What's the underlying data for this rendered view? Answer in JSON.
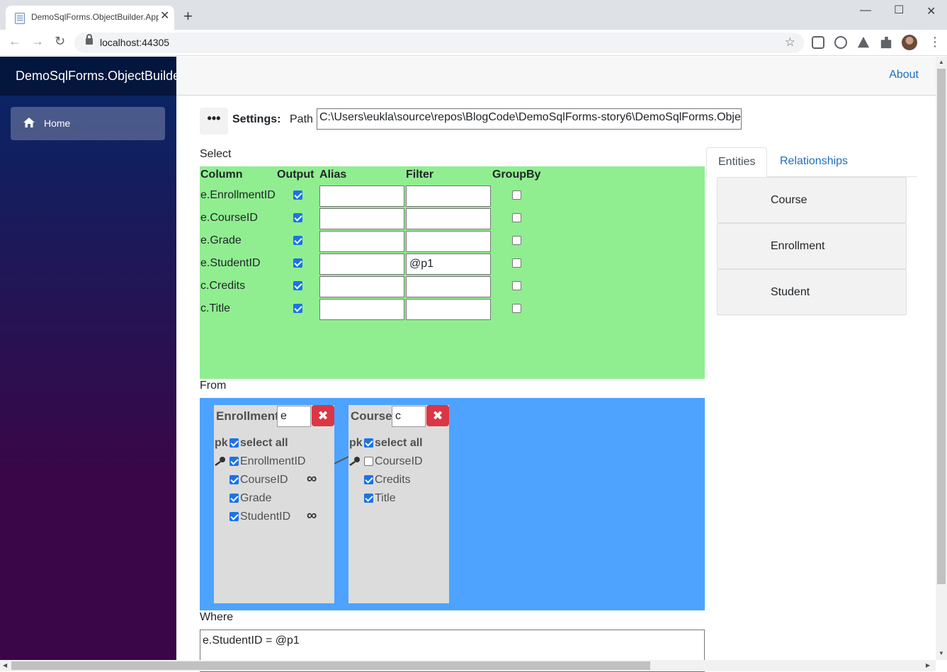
{
  "browser": {
    "tab_title": "DemoSqlForms.ObjectBuilder.App",
    "url": "localhost:44305"
  },
  "app": {
    "brand": "DemoSqlForms.ObjectBuilder.App",
    "nav": [
      {
        "label": "Home",
        "icon": "home-icon"
      }
    ],
    "about_label": "About"
  },
  "settings": {
    "button_label": "•••",
    "label": "Settings:",
    "path_label": "Path",
    "path_value": "C:\\Users\\eukla\\source\\repos\\BlogCode\\DemoSqlForms-story6\\DemoSqlForms.ObjectBuilder.App"
  },
  "select": {
    "section_label": "Select",
    "headers": {
      "column": "Column",
      "output": "Output",
      "alias": "Alias",
      "filter": "Filter",
      "groupby": "GroupBy"
    },
    "rows": [
      {
        "column": "e.EnrollmentID",
        "output": true,
        "alias": "",
        "filter": "",
        "groupby": false
      },
      {
        "column": "e.CourseID",
        "output": true,
        "alias": "",
        "filter": "",
        "groupby": false
      },
      {
        "column": "e.Grade",
        "output": true,
        "alias": "",
        "filter": "",
        "groupby": false
      },
      {
        "column": "e.StudentID",
        "output": true,
        "alias": "",
        "filter": "@p1",
        "groupby": false
      },
      {
        "column": "c.Credits",
        "output": true,
        "alias": "",
        "filter": "",
        "groupby": false
      },
      {
        "column": "c.Title",
        "output": true,
        "alias": "",
        "filter": "",
        "groupby": false
      }
    ],
    "bg_color": "#90ee90"
  },
  "from": {
    "section_label": "From",
    "bg_color": "#4da3ff",
    "tables": [
      {
        "name": "Enrollment",
        "alias": "e",
        "pk_label": "pk",
        "select_all_label": "select all",
        "columns": [
          {
            "name": "EnrollmentID",
            "checked": true,
            "pk": true,
            "fk": false
          },
          {
            "name": "CourseID",
            "checked": true,
            "pk": false,
            "fk": true
          },
          {
            "name": "Grade",
            "checked": true,
            "pk": false,
            "fk": false
          },
          {
            "name": "StudentID",
            "checked": true,
            "pk": false,
            "fk": true
          }
        ]
      },
      {
        "name": "Course",
        "alias": "c",
        "pk_label": "pk",
        "select_all_label": "select all",
        "columns": [
          {
            "name": "CourseID",
            "checked": false,
            "pk": true,
            "fk": false
          },
          {
            "name": "Credits",
            "checked": true,
            "pk": false,
            "fk": false
          },
          {
            "name": "Title",
            "checked": true,
            "pk": false,
            "fk": false
          }
        ]
      }
    ],
    "remove_glyph": "✖",
    "fk_glyph": "∞"
  },
  "where": {
    "section_label": "Where",
    "value": "e.StudentID = @p1"
  },
  "right_panel": {
    "tabs": [
      {
        "label": "Entities",
        "active": true
      },
      {
        "label": "Relationships",
        "active": false
      }
    ],
    "entities": [
      "Course",
      "Enrollment",
      "Student"
    ]
  }
}
